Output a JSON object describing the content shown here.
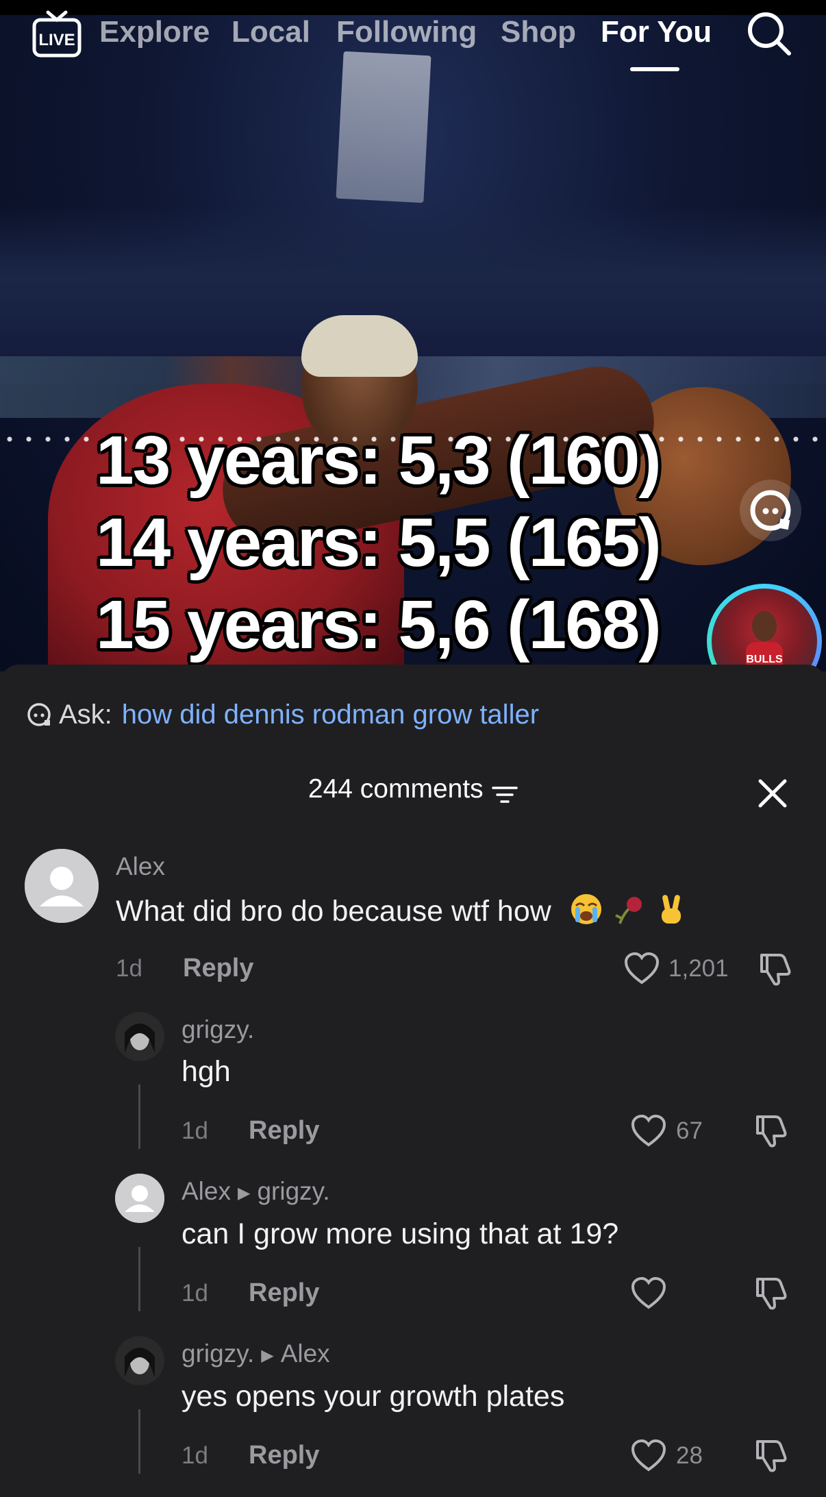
{
  "nav": {
    "live_label": "LIVE",
    "tabs": [
      {
        "label": "Explore"
      },
      {
        "label": "Local"
      },
      {
        "label": "Following"
      },
      {
        "label": "Shop"
      },
      {
        "label": "For You",
        "active": true
      }
    ]
  },
  "video": {
    "overlay_lines": [
      "13 years: 5,3 (160)",
      "14 years: 5,5 (165)",
      "15 years: 5,6 (168)"
    ]
  },
  "ask": {
    "label": "Ask:",
    "query": "how did dennis rodman grow taller"
  },
  "comments_header": {
    "count_label": "244 comments"
  },
  "comments": [
    {
      "username": "Alex",
      "text": "What did bro do because wtf how",
      "time": "1d",
      "reply_label": "Reply",
      "likes": "1,201"
    },
    {
      "username": "grigzy.",
      "text": "hgh",
      "time": "1d",
      "reply_label": "Reply",
      "likes": "67"
    },
    {
      "username": "Alex",
      "reply_to": "grigzy.",
      "text": "can I grow more using that at 19?",
      "time": "1d",
      "reply_label": "Reply",
      "likes": ""
    },
    {
      "username": "grigzy.",
      "reply_to": "Alex",
      "text": "yes opens your growth plates",
      "time": "1d",
      "reply_label": "Reply",
      "likes": "28"
    }
  ],
  "colors": {
    "sheet_bg": "#1f1f21",
    "ask_query": "#7fb2ff",
    "ring_accent": "#3fd6ff"
  }
}
